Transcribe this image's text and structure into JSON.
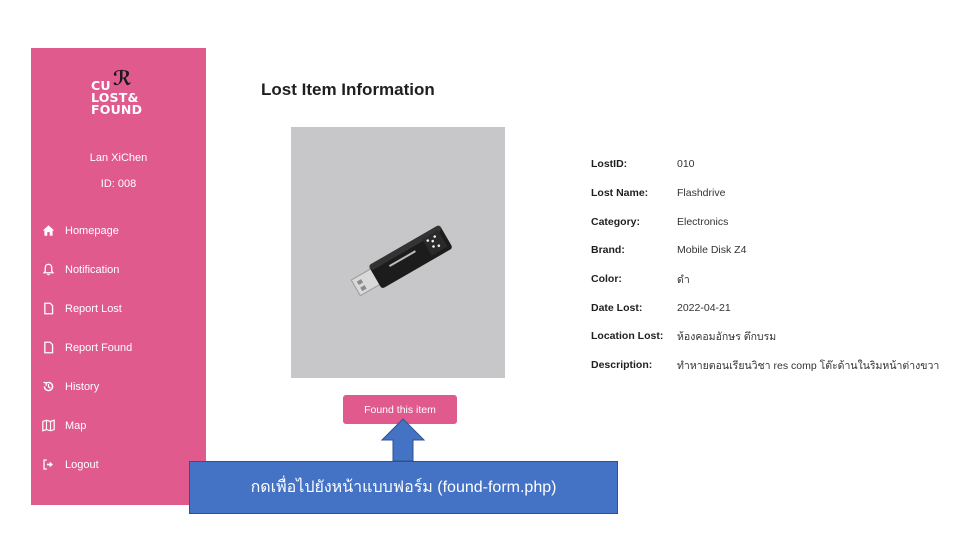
{
  "sidebar": {
    "logo_lines": [
      "CU",
      "LOST&",
      "FOUND"
    ],
    "user_name": "Lan XiChen",
    "user_id": "ID: 008",
    "items": [
      {
        "label": "Homepage",
        "icon": "home-icon"
      },
      {
        "label": "Notification",
        "icon": "bell-icon"
      },
      {
        "label": "Report Lost",
        "icon": "file-icon"
      },
      {
        "label": "Report Found",
        "icon": "file-icon"
      },
      {
        "label": "History",
        "icon": "history-icon"
      },
      {
        "label": "Map",
        "icon": "map-icon"
      },
      {
        "label": "Logout",
        "icon": "logout-icon"
      }
    ]
  },
  "main": {
    "title": "Lost Item Information",
    "found_button": "Found this item",
    "details": [
      {
        "key": "LostID:",
        "value": "010"
      },
      {
        "key": "Lost Name:",
        "value": "Flashdrive"
      },
      {
        "key": "Category:",
        "value": "Electronics"
      },
      {
        "key": "Brand:",
        "value": "Mobile Disk Z4"
      },
      {
        "key": "Color:",
        "value": "ดำ"
      },
      {
        "key": "Date Lost:",
        "value": "2022-04-21"
      },
      {
        "key": "Location Lost:",
        "value": "ห้องคอมอักษร ตึกบรม"
      },
      {
        "key": "Description:",
        "value": "ทำหายตอนเรียนวิชา res comp โต๊ะด้านในริมหน้าต่างขวา"
      }
    ]
  },
  "callout": {
    "text": "กดเพื่อไปยังหน้าแบบฟอร์ม (found-form.php)"
  },
  "colors": {
    "accent": "#e05a8e",
    "callout": "#4472c4",
    "photo_bg": "#c7c6c8"
  }
}
